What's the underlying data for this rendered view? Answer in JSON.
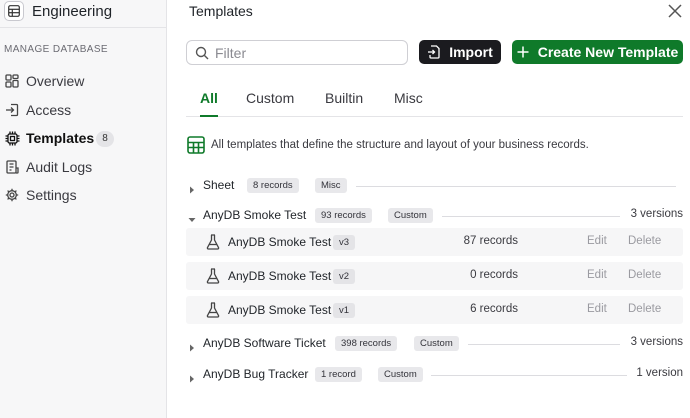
{
  "sidebar": {
    "workspace": "Engineering",
    "section_label": "MANAGE DATABASE",
    "items": [
      {
        "label": "Overview"
      },
      {
        "label": "Access"
      },
      {
        "label": "Templates",
        "badge": "8"
      },
      {
        "label": "Audit Logs"
      },
      {
        "label": "Settings"
      }
    ]
  },
  "panel": {
    "title": "Templates",
    "filter_placeholder": "Filter",
    "import_label": "Import",
    "create_label": "Create New Template",
    "tabs": [
      {
        "label": "All"
      },
      {
        "label": "Custom"
      },
      {
        "label": "Builtin"
      },
      {
        "label": "Misc"
      }
    ],
    "description": "All templates that define the structure and layout of your business records."
  },
  "groups": [
    {
      "name": "Sheet",
      "records": "8 records",
      "tag": "Misc",
      "versions": ""
    },
    {
      "name": "AnyDB Smoke Test",
      "records": "93 records",
      "tag": "Custom",
      "versions": "3 versions",
      "children": [
        {
          "name": "AnyDB Smoke Test",
          "version": "v3",
          "records": "87 records",
          "edit": "Edit",
          "delete": "Delete"
        },
        {
          "name": "AnyDB Smoke Test",
          "version": "v2",
          "records": "0 records",
          "edit": "Edit",
          "delete": "Delete"
        },
        {
          "name": "AnyDB Smoke Test",
          "version": "v1",
          "records": "6 records",
          "edit": "Edit",
          "delete": "Delete"
        }
      ]
    },
    {
      "name": "AnyDB Software Ticket",
      "records": "398 records",
      "tag": "Custom",
      "versions": "3 versions"
    },
    {
      "name": "AnyDB Bug Tracker",
      "records": "1 record",
      "tag": "Custom",
      "versions": "1 version"
    }
  ],
  "colors": {
    "accent": "#0f7a2a",
    "dark_button": "#1b1b1f",
    "sidebar_bg": "#f7f7f8"
  },
  "icons": [
    "table-icon",
    "grid-icon",
    "login-icon",
    "chip-icon",
    "audit-log-icon",
    "gear-icon",
    "close-icon",
    "search-icon",
    "import-icon",
    "plus-icon",
    "flask-icon",
    "chevron-right-icon",
    "chevron-down-icon"
  ]
}
